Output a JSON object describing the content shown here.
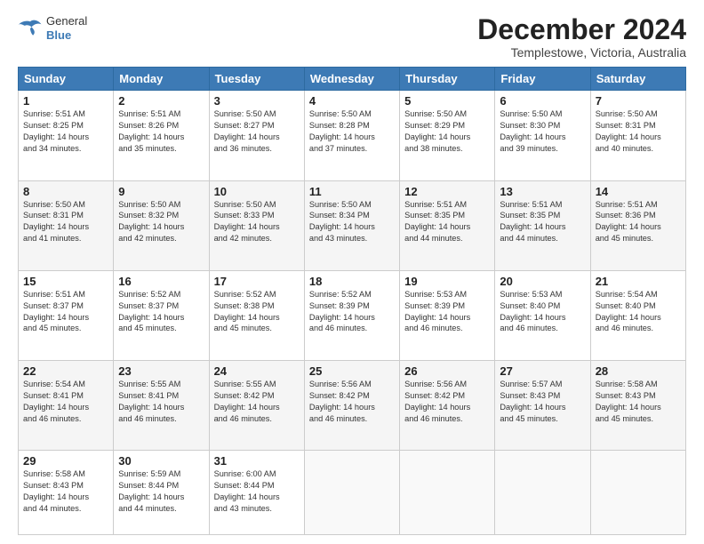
{
  "header": {
    "logo": {
      "line1": "General",
      "line2": "Blue"
    },
    "title": "December 2024",
    "subtitle": "Templestowe, Victoria, Australia"
  },
  "calendar": {
    "headers": [
      "Sunday",
      "Monday",
      "Tuesday",
      "Wednesday",
      "Thursday",
      "Friday",
      "Saturday"
    ],
    "weeks": [
      [
        {
          "day": "",
          "content": ""
        },
        {
          "day": "2",
          "content": "Sunrise: 5:51 AM\nSunset: 8:26 PM\nDaylight: 14 hours\nand 35 minutes."
        },
        {
          "day": "3",
          "content": "Sunrise: 5:50 AM\nSunset: 8:27 PM\nDaylight: 14 hours\nand 36 minutes."
        },
        {
          "day": "4",
          "content": "Sunrise: 5:50 AM\nSunset: 8:28 PM\nDaylight: 14 hours\nand 37 minutes."
        },
        {
          "day": "5",
          "content": "Sunrise: 5:50 AM\nSunset: 8:29 PM\nDaylight: 14 hours\nand 38 minutes."
        },
        {
          "day": "6",
          "content": "Sunrise: 5:50 AM\nSunset: 8:30 PM\nDaylight: 14 hours\nand 39 minutes."
        },
        {
          "day": "7",
          "content": "Sunrise: 5:50 AM\nSunset: 8:31 PM\nDaylight: 14 hours\nand 40 minutes."
        }
      ],
      [
        {
          "day": "8",
          "content": "Sunrise: 5:50 AM\nSunset: 8:31 PM\nDaylight: 14 hours\nand 41 minutes."
        },
        {
          "day": "9",
          "content": "Sunrise: 5:50 AM\nSunset: 8:32 PM\nDaylight: 14 hours\nand 42 minutes."
        },
        {
          "day": "10",
          "content": "Sunrise: 5:50 AM\nSunset: 8:33 PM\nDaylight: 14 hours\nand 42 minutes."
        },
        {
          "day": "11",
          "content": "Sunrise: 5:50 AM\nSunset: 8:34 PM\nDaylight: 14 hours\nand 43 minutes."
        },
        {
          "day": "12",
          "content": "Sunrise: 5:51 AM\nSunset: 8:35 PM\nDaylight: 14 hours\nand 44 minutes."
        },
        {
          "day": "13",
          "content": "Sunrise: 5:51 AM\nSunset: 8:35 PM\nDaylight: 14 hours\nand 44 minutes."
        },
        {
          "day": "14",
          "content": "Sunrise: 5:51 AM\nSunset: 8:36 PM\nDaylight: 14 hours\nand 45 minutes."
        }
      ],
      [
        {
          "day": "15",
          "content": "Sunrise: 5:51 AM\nSunset: 8:37 PM\nDaylight: 14 hours\nand 45 minutes."
        },
        {
          "day": "16",
          "content": "Sunrise: 5:52 AM\nSunset: 8:37 PM\nDaylight: 14 hours\nand 45 minutes."
        },
        {
          "day": "17",
          "content": "Sunrise: 5:52 AM\nSunset: 8:38 PM\nDaylight: 14 hours\nand 45 minutes."
        },
        {
          "day": "18",
          "content": "Sunrise: 5:52 AM\nSunset: 8:39 PM\nDaylight: 14 hours\nand 46 minutes."
        },
        {
          "day": "19",
          "content": "Sunrise: 5:53 AM\nSunset: 8:39 PM\nDaylight: 14 hours\nand 46 minutes."
        },
        {
          "day": "20",
          "content": "Sunrise: 5:53 AM\nSunset: 8:40 PM\nDaylight: 14 hours\nand 46 minutes."
        },
        {
          "day": "21",
          "content": "Sunrise: 5:54 AM\nSunset: 8:40 PM\nDaylight: 14 hours\nand 46 minutes."
        }
      ],
      [
        {
          "day": "22",
          "content": "Sunrise: 5:54 AM\nSunset: 8:41 PM\nDaylight: 14 hours\nand 46 minutes."
        },
        {
          "day": "23",
          "content": "Sunrise: 5:55 AM\nSunset: 8:41 PM\nDaylight: 14 hours\nand 46 minutes."
        },
        {
          "day": "24",
          "content": "Sunrise: 5:55 AM\nSunset: 8:42 PM\nDaylight: 14 hours\nand 46 minutes."
        },
        {
          "day": "25",
          "content": "Sunrise: 5:56 AM\nSunset: 8:42 PM\nDaylight: 14 hours\nand 46 minutes."
        },
        {
          "day": "26",
          "content": "Sunrise: 5:56 AM\nSunset: 8:42 PM\nDaylight: 14 hours\nand 46 minutes."
        },
        {
          "day": "27",
          "content": "Sunrise: 5:57 AM\nSunset: 8:43 PM\nDaylight: 14 hours\nand 45 minutes."
        },
        {
          "day": "28",
          "content": "Sunrise: 5:58 AM\nSunset: 8:43 PM\nDaylight: 14 hours\nand 45 minutes."
        }
      ],
      [
        {
          "day": "29",
          "content": "Sunrise: 5:58 AM\nSunset: 8:43 PM\nDaylight: 14 hours\nand 44 minutes."
        },
        {
          "day": "30",
          "content": "Sunrise: 5:59 AM\nSunset: 8:44 PM\nDaylight: 14 hours\nand 44 minutes."
        },
        {
          "day": "31",
          "content": "Sunrise: 6:00 AM\nSunset: 8:44 PM\nDaylight: 14 hours\nand 43 minutes."
        },
        {
          "day": "",
          "content": ""
        },
        {
          "day": "",
          "content": ""
        },
        {
          "day": "",
          "content": ""
        },
        {
          "day": "",
          "content": ""
        }
      ]
    ],
    "week1_day1": {
      "day": "1",
      "content": "Sunrise: 5:51 AM\nSunset: 8:25 PM\nDaylight: 14 hours\nand 34 minutes."
    }
  }
}
